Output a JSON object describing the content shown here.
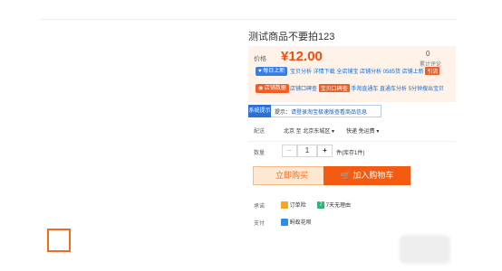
{
  "product": {
    "title": "测试商品不要拍123",
    "price_label": "价格",
    "price": "¥12.00",
    "sales_count": "0",
    "sales_label": "累计评论"
  },
  "promo": {
    "badge1": "每日上新",
    "line1": "宝贝分析 详情下载 全店铺宝 店铺分析 0585货 店铺上新",
    "line1_tag": "引流",
    "badge2": "店铺数据",
    "line2_a": "店铺口碑查",
    "line2_tag": "宝贝口碑查",
    "line2_b": "手淘直通车 直通车分析 5分钟搜出宝贝"
  },
  "tip": {
    "tag": "系统提示",
    "prefix": "提示：",
    "link": "请登录淘宝极速版查看商品信息"
  },
  "shipping": {
    "label": "配送",
    "from": "北京 至 北京东城区",
    "fee": "快递 免运费"
  },
  "quantity": {
    "label": "数量",
    "minus": "−",
    "value": "1",
    "plus": "+",
    "stock": "件(库存1件)"
  },
  "actions": {
    "buy_now": "立即购买",
    "add_to_cart": "加入购物车"
  },
  "service": {
    "label": "承诺",
    "item1": "订单险",
    "item2_num": "7",
    "item2": "7天无理由"
  },
  "payment": {
    "label": "支付",
    "item1": "蚂蚁花呗"
  },
  "colors": {
    "accent": "#f35b12",
    "price": "#f34f0f",
    "panel_bg": "#fff2e8",
    "link": "#1a6fd0"
  }
}
